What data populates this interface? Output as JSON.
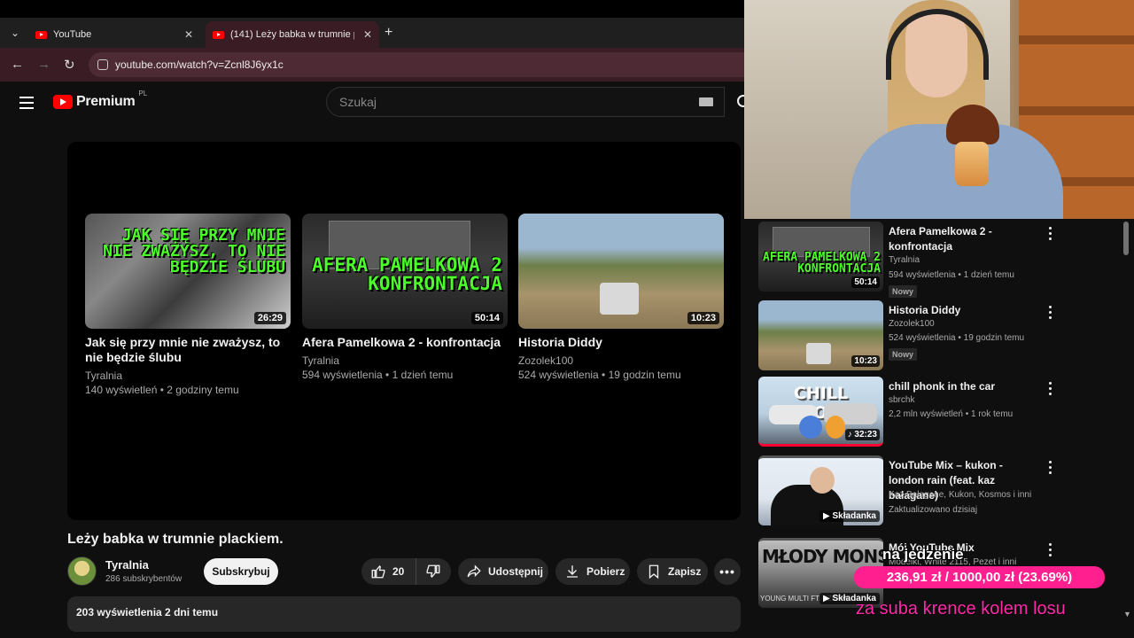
{
  "browser": {
    "tabs": [
      {
        "title": "YouTube"
      },
      {
        "title": "(141) Leży babka w trumnie plackiem. - YouTube"
      }
    ],
    "close_glyph": "✕",
    "new_tab": "+",
    "url": "youtube.com/watch?v=Zcnl8J6yx1c"
  },
  "header": {
    "logo": "Premium",
    "region": "PL",
    "search_placeholder": "Szukaj"
  },
  "end_cards": [
    {
      "thumb_text": "JAK SIĘ PRZY MNIE NIE ZWAŻYSZ, TO NIE BĘDZIE ŚLUBU",
      "duration": "26:29",
      "title": "Jak się przy mnie nie zważysz, to nie będzie ślubu",
      "channel": "Tyralnia",
      "meta": "140 wyświetleń • 2 godziny temu"
    },
    {
      "thumb_text": "AFERA PAMELKOWA 2 KONFRONTACJA",
      "duration": "50:14",
      "title": "Afera Pamelkowa 2 - konfrontacja",
      "channel": "Tyralnia",
      "meta": "594 wyświetlenia • 1 dzień temu"
    },
    {
      "thumb_text": "",
      "duration": "10:23",
      "title": "Historia Diddy",
      "channel": "Zozolek100",
      "meta": "524 wyświetlenia • 19 godzin temu"
    }
  ],
  "video": {
    "title": "Leży babka w trumnie plackiem.",
    "channel": "Tyralnia",
    "subscribers": "286 subskrybentów",
    "subscribe_label": "Subskrybuj",
    "likes": "20",
    "share_label": "Udostępnij",
    "download_label": "Pobierz",
    "save_label": "Zapisz",
    "more_label": "•••",
    "description_meta": "203 wyświetlenia  2 dni temu"
  },
  "sidebar": [
    {
      "title": "Afera Pamelkowa 2 - konfrontacja",
      "channel": "Tyralnia",
      "meta": "594 wyświetlenia • 1 dzień temu",
      "badge": "Nowy",
      "duration": "50:14",
      "thumb_text": "AFERA PAMELKOWA 2 KONFRONTACJA"
    },
    {
      "title": "Historia Diddy",
      "channel": "Zozolek100",
      "meta": "524 wyświetlenia • 19 godzin temu",
      "badge": "Nowy",
      "duration": "10:23"
    },
    {
      "title": "chill phonk in the car",
      "channel": "sbrchk",
      "meta": "2,2 mln wyświetleń • 1 rok temu",
      "duration": "♪ 32:23",
      "thumb_text": "CHILL PHONK"
    },
    {
      "title": "YouTube Mix – kukon - london rain (feat. kaz bałagane)",
      "channel": "Kaz Bałagane, Kukon, Kosmos i inni",
      "meta": "Zaktualizowano dzisiaj",
      "mix_label": "Składanka"
    },
    {
      "title": "Mój YouTube Mix",
      "channel": "Modelki, White 2115, Pezet i inni",
      "mix_label": "Składanka",
      "thumb_text": "MŁODY MONSUN",
      "thumb_subtext": "YOUNG MULTI FT. SZPAKU"
    }
  ],
  "overlay": {
    "line1": "na jedzenie",
    "progress_text": "236,91 zł / 1000,00 zł (23.69%)",
    "progress_fraction": 0.2369,
    "line2": "za suba krence kolem losu"
  },
  "colors": {
    "accent": "#ff0000",
    "overlay_pink": "#ff1f8e",
    "thumb_green": "#4cff2a"
  },
  "icons": [
    "youtube-icon",
    "hamburger-icon",
    "search-icon",
    "keyboard-icon",
    "like-icon",
    "dislike-icon",
    "share-icon",
    "download-icon",
    "save-icon",
    "more-icon",
    "kebab-icon"
  ]
}
